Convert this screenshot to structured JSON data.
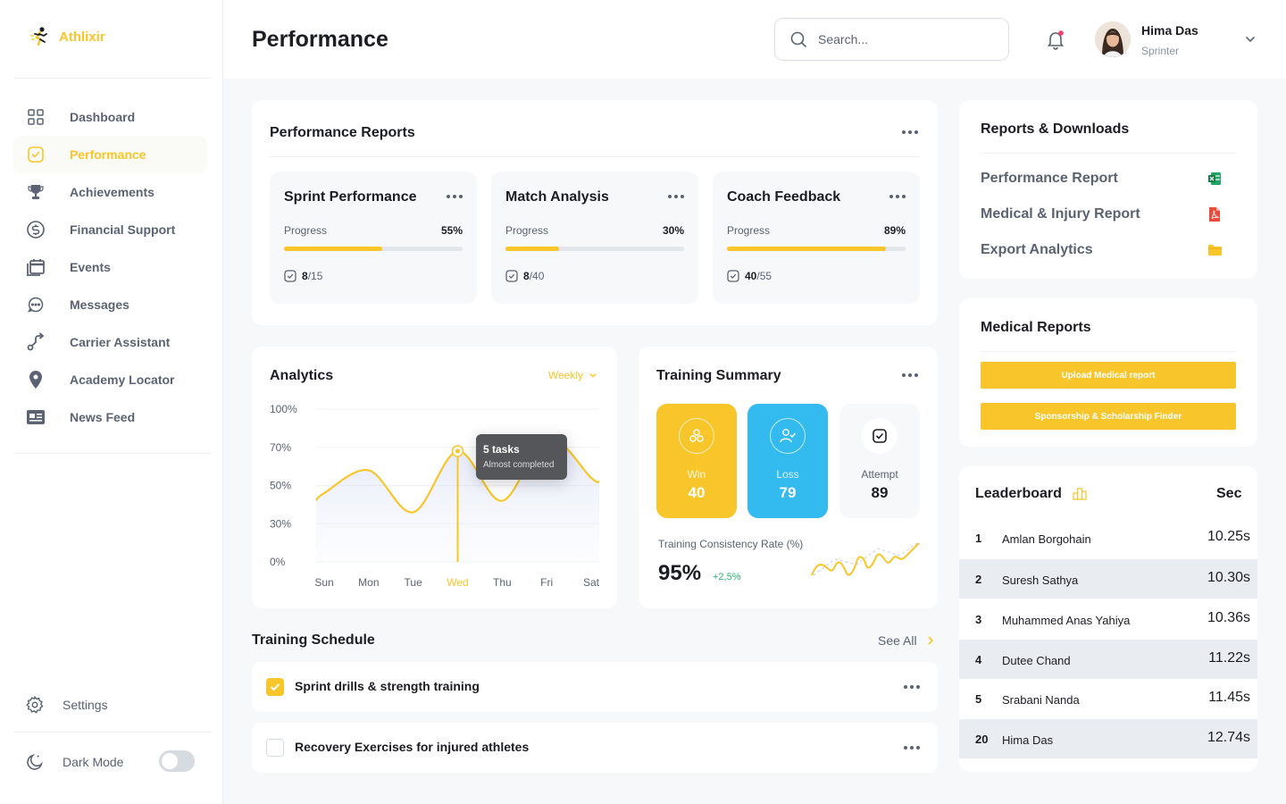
{
  "app": {
    "name": "Athlixir"
  },
  "colors": {
    "accent": "#F8C62A",
    "blue": "#33BBF0",
    "muted": "#5B6372",
    "text": "#1C1D22",
    "positive": "#2BB673"
  },
  "sidebar": {
    "items": [
      {
        "label": "Dashboard",
        "icon": "grid-icon"
      },
      {
        "label": "Performance",
        "icon": "checkbox-icon"
      },
      {
        "label": "Achievements",
        "icon": "trophy-icon"
      },
      {
        "label": "Financial Support",
        "icon": "dollar-icon"
      },
      {
        "label": "Events",
        "icon": "calendar-icon"
      },
      {
        "label": "Messages",
        "icon": "chat-icon"
      },
      {
        "label": "Carrier Assistant",
        "icon": "route-icon"
      },
      {
        "label": "Academy Locator",
        "icon": "location-icon"
      },
      {
        "label": "News Feed",
        "icon": "news-icon"
      }
    ],
    "active": "Performance",
    "settings_label": "Settings",
    "dark_mode_label": "Dark Mode",
    "dark_mode_on": false
  },
  "header": {
    "title": "Performance",
    "search_placeholder": "Search...",
    "user": {
      "name": "Hima Das",
      "role": "Sprinter"
    }
  },
  "reports": {
    "title": "Performance Reports",
    "progress_label": "Progress",
    "items": [
      {
        "title": "Sprint Performance",
        "progress": "55%",
        "progress_value": 55,
        "done": "8",
        "total": "/15"
      },
      {
        "title": "Match Analysis",
        "progress": "30%",
        "progress_value": 30,
        "done": "8",
        "total": "/40"
      },
      {
        "title": "Coach Feedback",
        "progress": "89%",
        "progress_value": 89,
        "done": "40",
        "total": "/55"
      }
    ]
  },
  "analytics": {
    "title": "Analytics",
    "period": "Weekly",
    "tooltip": {
      "title": "5 tasks",
      "subtitle": "Almost completed"
    }
  },
  "chart_data": {
    "type": "area",
    "categories": [
      "Sun",
      "Mon",
      "Tue",
      "Wed",
      "Thu",
      "Fri",
      "Sat"
    ],
    "y_ticks": [
      "100%",
      "70%",
      "50%",
      "30%",
      "0%"
    ],
    "y_tick_values": [
      100,
      70,
      50,
      30,
      0
    ],
    "values": [
      46,
      58,
      36,
      68,
      42,
      78,
      54
    ],
    "highlight_category": "Wed",
    "ylim": [
      0,
      100
    ],
    "grid": true
  },
  "training_summary": {
    "title": "Training Summary",
    "win": {
      "label": "Win",
      "value": "40"
    },
    "loss": {
      "label": "Loss",
      "value": "79"
    },
    "attempt": {
      "label": "Attempt",
      "value": "89"
    },
    "consistency_label": "Training Consistency Rate (%)",
    "consistency_value": "95%",
    "consistency_change": "+2,5%"
  },
  "schedule": {
    "title": "Training Schedule",
    "see_all": "See All",
    "items": [
      {
        "label": "Sprint drills & strength training",
        "checked": true
      },
      {
        "label": "Recovery Exercises for injured athletes",
        "checked": false
      }
    ]
  },
  "downloads": {
    "title": "Reports & Downloads",
    "items": [
      {
        "label": "Performance Report",
        "icon": "excel-icon"
      },
      {
        "label": "Medical & Injury Report",
        "icon": "pdf-icon"
      },
      {
        "label": "Export Analytics",
        "icon": "folder-icon"
      }
    ]
  },
  "medical": {
    "title": "Medical Reports",
    "upload_label": "Upload Medical report",
    "sponsor_label": "Sponsorship & Scholarship Finder"
  },
  "leaderboard": {
    "title": "Leaderboard",
    "col_label": "Sec",
    "rows": [
      {
        "rank": "1",
        "name": "Amlan Borgohain",
        "time": "10.25s"
      },
      {
        "rank": "2",
        "name": "Suresh Sathya",
        "time": "10.30s"
      },
      {
        "rank": "3",
        "name": "Muhammed Anas Yahiya",
        "time": "10.36s"
      },
      {
        "rank": "4",
        "name": "Dutee Chand",
        "time": "11.22s"
      },
      {
        "rank": "5",
        "name": "Srabani Nanda",
        "time": "11.45s"
      },
      {
        "rank": "20",
        "name": "Hima Das",
        "time": "12.74s"
      }
    ]
  }
}
